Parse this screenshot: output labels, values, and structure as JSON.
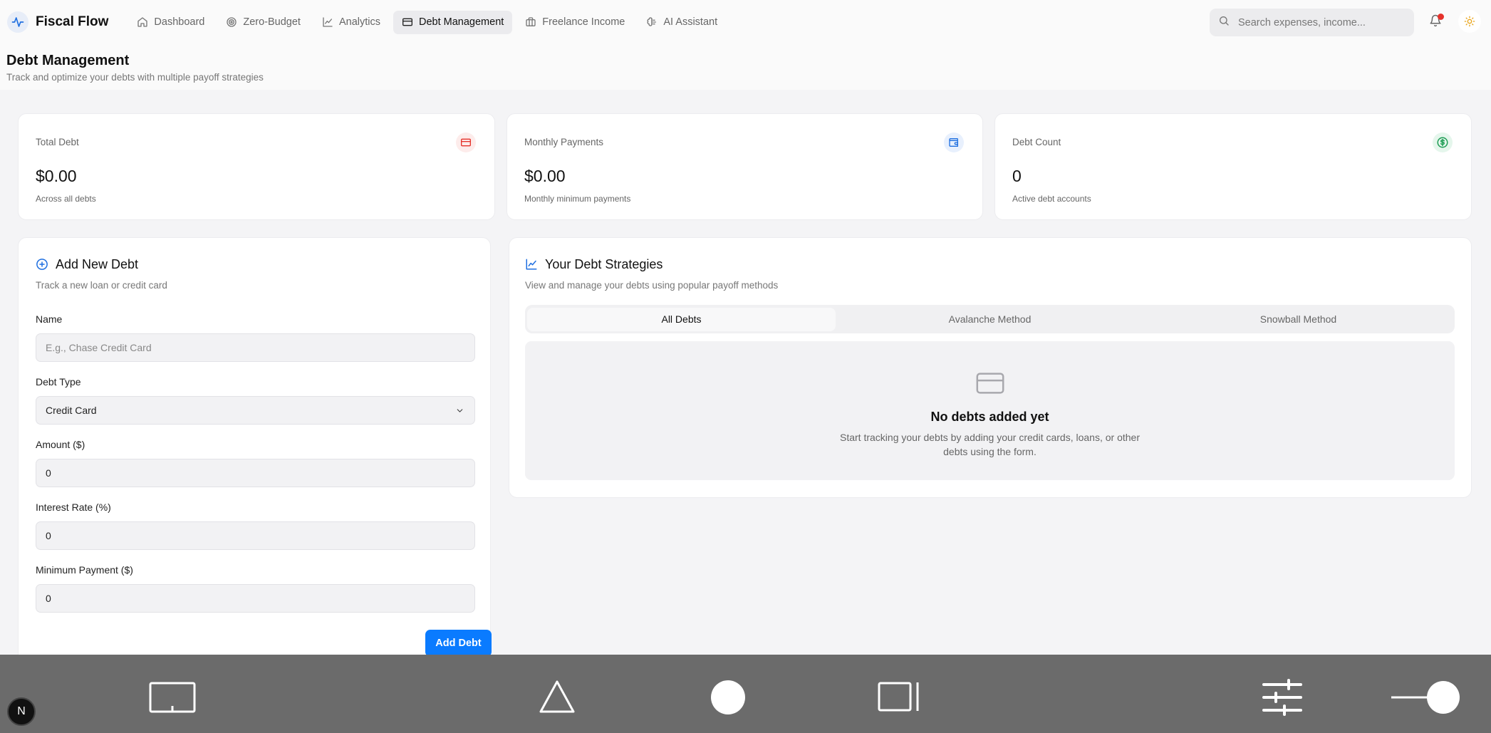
{
  "app": {
    "name": "Fiscal Flow"
  },
  "nav": {
    "items": [
      {
        "label": "Dashboard",
        "icon": "home-icon",
        "active": false
      },
      {
        "label": "Zero-Budget",
        "icon": "target-icon",
        "active": false
      },
      {
        "label": "Analytics",
        "icon": "line-chart-icon",
        "active": false
      },
      {
        "label": "Debt Management",
        "icon": "credit-card-icon",
        "active": true
      },
      {
        "label": "Freelance Income",
        "icon": "briefcase-icon",
        "active": false
      },
      {
        "label": "AI Assistant",
        "icon": "brain-icon",
        "active": false
      }
    ]
  },
  "search": {
    "placeholder": "Search expenses, income..."
  },
  "page": {
    "title": "Debt Management",
    "subtitle": "Track and optimize your debts with multiple payoff strategies"
  },
  "stats": [
    {
      "label": "Total Debt",
      "value": "$0.00",
      "sub": "Across all debts",
      "icon": "credit-card-icon",
      "color": "#e5322b",
      "bg": "#fdeceb"
    },
    {
      "label": "Monthly Payments",
      "value": "$0.00",
      "sub": "Monthly minimum payments",
      "icon": "wallet-icon",
      "color": "#1f6fe0",
      "bg": "#e8f0fd"
    },
    {
      "label": "Debt Count",
      "value": "0",
      "sub": "Active debt accounts",
      "icon": "dollar-circle-icon",
      "color": "#1f9d55",
      "bg": "#e5f6ec"
    }
  ],
  "form": {
    "title": "Add New Debt",
    "description": "Track a new loan or credit card",
    "name_label": "Name",
    "name_placeholder": "E.g., Chase Credit Card",
    "type_label": "Debt Type",
    "type_value": "Credit Card",
    "amount_label": "Amount ($)",
    "amount_value": "0",
    "rate_label": "Interest Rate (%)",
    "rate_value": "0",
    "minpay_label": "Minimum Payment ($)",
    "minpay_value": "0",
    "submit_label": "Add Debt"
  },
  "strategies": {
    "title": "Your Debt Strategies",
    "description": "View and manage your debts using popular payoff methods",
    "tabs": [
      "All Debts",
      "Avalanche Method",
      "Snowball Method"
    ],
    "active_tab": 0,
    "empty_title": "No debts added yet",
    "empty_text": "Start tracking your debts by adding your credit cards, loans, or other debts using the form."
  },
  "badge": {
    "letter": "N"
  },
  "colors": {
    "accent": "#0a7bff",
    "sysbar": "#6b6b6b"
  }
}
